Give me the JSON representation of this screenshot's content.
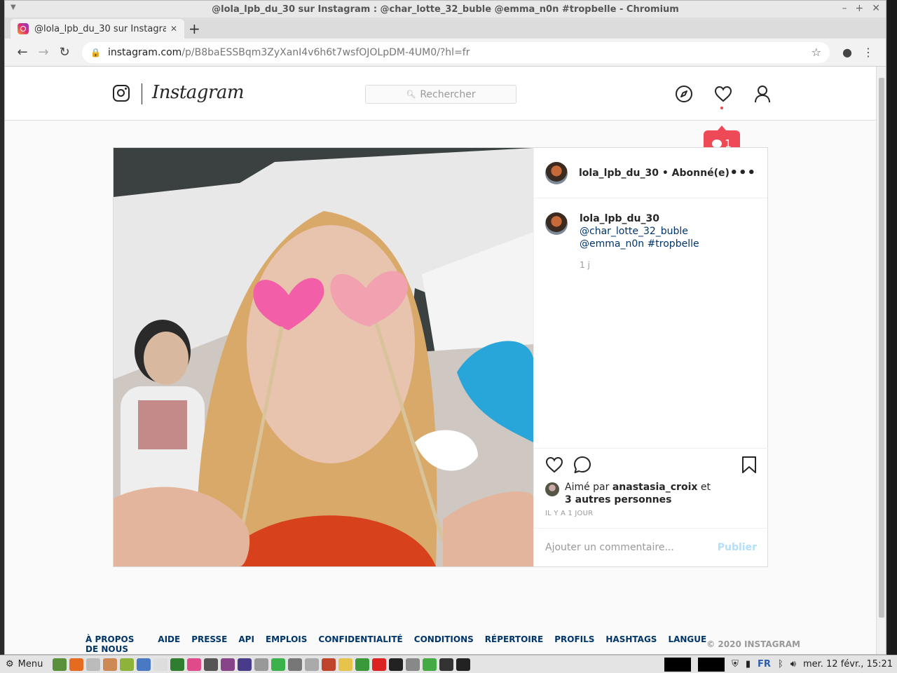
{
  "window": {
    "title": "@lola_lpb_du_30 sur Instagram : @char_lotte_32_buble @emma_n0n #tropbelle - Chromium"
  },
  "tab": {
    "title": "@lola_lpb_du_30 sur Instagram"
  },
  "address": {
    "host": "instagram.com",
    "path": "/p/B8baESSBqm3ZyXanI4v6h6t7wsfOJOLpDM-4UM0/?hl=fr"
  },
  "header": {
    "wordmark": "Instagram",
    "search_placeholder": "Rechercher",
    "notifications_count": "1"
  },
  "post": {
    "author": "lola_lpb_du_30 • Abonné(e)",
    "caption_user": "lola_lpb_du_30",
    "caption_text": "@char_lotte_32_buble @emma_n0n #tropbelle",
    "caption_age": "1 j",
    "liked_prefix": "Aimé par ",
    "liked_user": "anastasia_croix",
    "liked_and": " et",
    "liked_others": "3 autres personnes",
    "timestamp": "IL Y A 1 JOUR",
    "comment_placeholder": "Ajouter un commentaire...",
    "publish_label": "Publier"
  },
  "footer": {
    "links": [
      "À PROPOS DE NOUS",
      "AIDE",
      "PRESSE",
      "API",
      "EMPLOIS",
      "CONFIDENTIALITÉ",
      "CONDITIONS",
      "RÉPERTOIRE",
      "PROFILS",
      "HASHTAGS",
      "LANGUE"
    ],
    "copyright": "© 2020 INSTAGRAM"
  },
  "taskbar": {
    "menu_label": "Menu",
    "keyboard_layout": "FR",
    "clock": "mer. 12 févr., 15:21"
  },
  "colors": {
    "accent_red": "#ed4956",
    "link_blue": "#003569",
    "publish_disabled": "#b2dffc"
  }
}
